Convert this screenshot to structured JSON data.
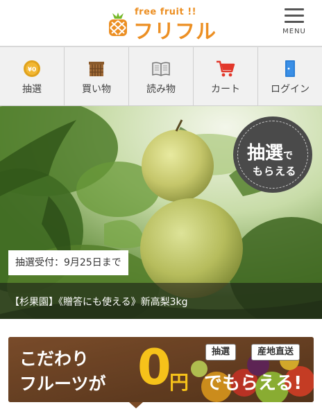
{
  "header": {
    "logo_subtitle": "free fruit !!",
    "logo_text": "フリフル",
    "menu_label": "MENU"
  },
  "nav": {
    "items": [
      {
        "label": "抽選",
        "icon": "coin-icon",
        "icon_text": "¥0"
      },
      {
        "label": "買い物",
        "icon": "basket-icon"
      },
      {
        "label": "読み物",
        "icon": "book-icon"
      },
      {
        "label": "カート",
        "icon": "cart-icon"
      },
      {
        "label": "ログイン",
        "icon": "login-icon"
      }
    ]
  },
  "hero": {
    "badge_line1": "抽選",
    "badge_line1_small": "で",
    "badge_line2": "もらえる",
    "deadline": "抽選受付：9月25日まで",
    "caption": "【杉果園】《贈答にも使える》新高梨3kg"
  },
  "banner": {
    "line1": "こだわり",
    "line2": "フルーツが",
    "zero": "0",
    "yen": "円",
    "moraeru": "でもらえる!",
    "tags": [
      "抽選",
      "産地直送"
    ]
  },
  "colors": {
    "brand_orange": "#ec8f23",
    "banner_yellow": "#f6c21a",
    "cart_red": "#e2382b",
    "login_blue": "#2b7fd6"
  }
}
